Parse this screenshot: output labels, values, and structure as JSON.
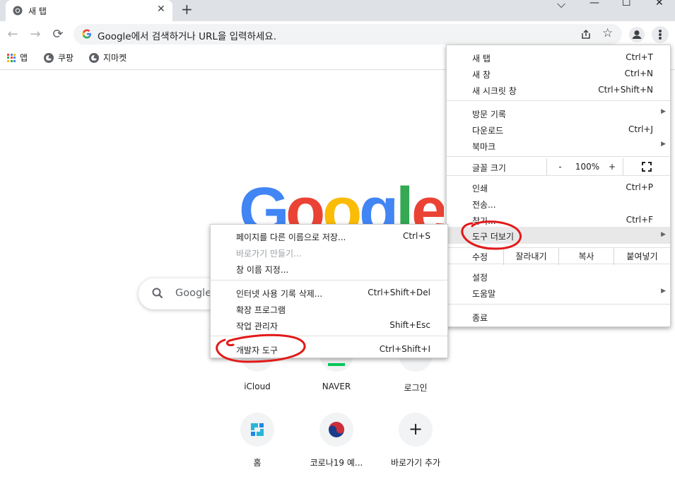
{
  "tab": {
    "title": "새 탭",
    "close": "✕"
  },
  "newtab": "+",
  "window_controls": {
    "dropdown": "⌵",
    "minimize": "—",
    "maximize": "☐",
    "close": "✕"
  },
  "toolbar": {
    "back": "←",
    "forward": "→",
    "reload": "⟳",
    "omnibox_placeholder": "Google에서 검색하거나 URL을 입력하세요.",
    "star": "☆"
  },
  "bookmarks": [
    {
      "label": "앱"
    },
    {
      "label": "쿠팡"
    },
    {
      "label": "지마켓"
    }
  ],
  "logo": {
    "letters": [
      "G",
      "o",
      "o",
      "g",
      "l",
      "e"
    ],
    "colors": [
      "#4285f4",
      "#ea4335",
      "#fbbc05",
      "#4285f4",
      "#34a853",
      "#ea4335"
    ]
  },
  "search": {
    "placeholder": "Google"
  },
  "shortcuts": [
    {
      "label": "iCloud"
    },
    {
      "label": "NAVER"
    },
    {
      "label": "로그인"
    },
    {
      "label": "홈"
    },
    {
      "label": "코로나19 예..."
    },
    {
      "label": "바로가기 추가",
      "icon": "+"
    }
  ],
  "main_menu": {
    "new_tab": {
      "label": "새 탭",
      "shortcut": "Ctrl+T"
    },
    "new_window": {
      "label": "새 창",
      "shortcut": "Ctrl+N"
    },
    "incognito": {
      "label": "새 시크릿 창",
      "shortcut": "Ctrl+Shift+N"
    },
    "history": {
      "label": "방문 기록"
    },
    "downloads": {
      "label": "다운로드",
      "shortcut": "Ctrl+J"
    },
    "bookmarks": {
      "label": "북마크"
    },
    "zoom": {
      "label": "글꼴 크기",
      "minus": "-",
      "value": "100%",
      "plus": "+"
    },
    "print": {
      "label": "인쇄",
      "shortcut": "Ctrl+P"
    },
    "cast": {
      "label": "전송..."
    },
    "find": {
      "label": "찾기...",
      "shortcut": "Ctrl+F"
    },
    "more_tools": {
      "label": "도구 더보기"
    },
    "edit": {
      "label": "수정",
      "cut": "잘라내기",
      "copy": "복사",
      "paste": "붙여넣기"
    },
    "settings": {
      "label": "설정"
    },
    "help": {
      "label": "도움말"
    },
    "exit": {
      "label": "종료"
    },
    "submenu_arrow": "▶"
  },
  "sub_menu": {
    "save_page": {
      "label": "페이지를 다른 이름으로 저장...",
      "shortcut": "Ctrl+S"
    },
    "create_shortcut": {
      "label": "바로가기 만들기..."
    },
    "name_window": {
      "label": "창 이름 지정..."
    },
    "clear_data": {
      "label": "인터넷 사용 기록 삭제...",
      "shortcut": "Ctrl+Shift+Del"
    },
    "extensions": {
      "label": "확장 프로그램"
    },
    "task_manager": {
      "label": "작업 관리자",
      "shortcut": "Shift+Esc"
    },
    "devtools": {
      "label": "개발자 도구",
      "shortcut": "Ctrl+Shift+I"
    }
  },
  "colors": {
    "annotation": "#e31919",
    "highlight": "#e8e8e8"
  }
}
